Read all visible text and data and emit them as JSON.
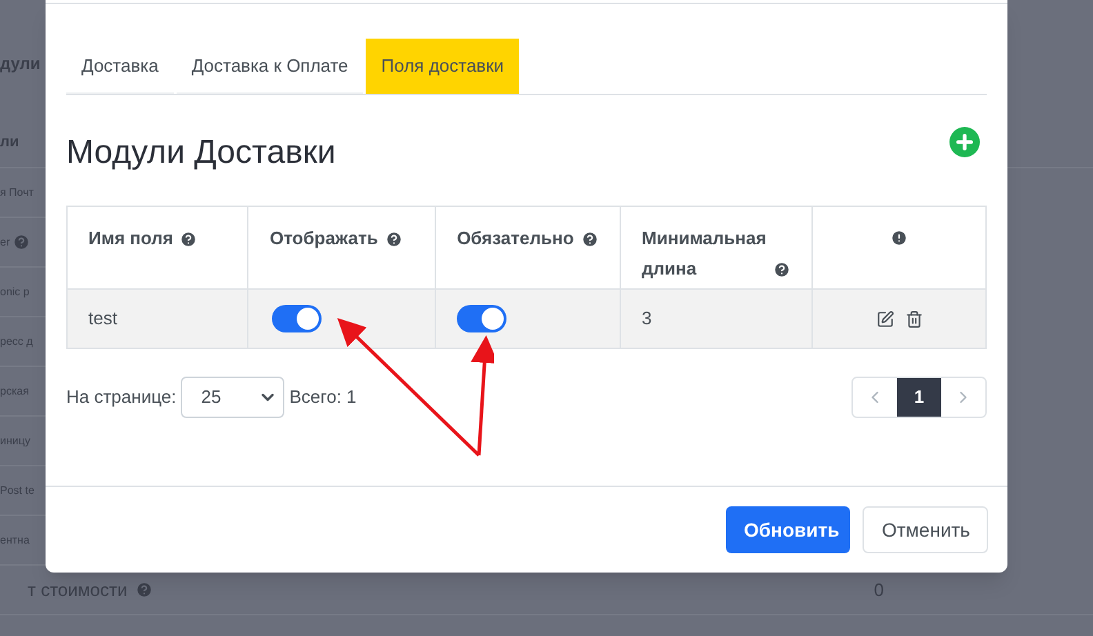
{
  "background_page": {
    "heading": "дули",
    "column_header": "ли",
    "rows": [
      {
        "label": "я Почт",
        "help": false
      },
      {
        "label": "er",
        "help": true
      },
      {
        "label": "onic p",
        "help": false
      },
      {
        "label": "ресс д",
        "help": false
      },
      {
        "label": "рская",
        "help": false
      },
      {
        "label": "иницу",
        "help": false
      },
      {
        "label": "Post te",
        "help": false
      },
      {
        "label": "ентна",
        "help": false
      }
    ],
    "visible_row": {
      "label": "т стоимости",
      "help": true,
      "value": "0"
    }
  },
  "modal": {
    "tabs": [
      {
        "label": "Доставка",
        "selected": false
      },
      {
        "label": "Доставка к Оплате",
        "selected": false
      },
      {
        "label": "Поля доставки",
        "selected": true
      }
    ],
    "title": "Модули Доставки",
    "table": {
      "columns": [
        {
          "label": "Имя поля",
          "help": true
        },
        {
          "label": "Отображать",
          "help": true
        },
        {
          "label": "Обязательно",
          "help": true
        },
        {
          "label": "Минимальная длина",
          "help": true
        },
        {
          "kind": "alert"
        }
      ],
      "rows": [
        {
          "name": "test",
          "display": {
            "on": true
          },
          "required": {
            "on": true
          },
          "min_length": "3"
        }
      ]
    },
    "pagination": {
      "per_page_label": "На странице:",
      "per_page_value": "25",
      "total": "Всего: 1",
      "pages": [
        {
          "label": "1",
          "selected": true
        }
      ]
    },
    "buttons": [
      {
        "label": "Обновить",
        "kind": "primary"
      },
      {
        "label": "Отменить",
        "kind": "secondary"
      }
    ]
  }
}
